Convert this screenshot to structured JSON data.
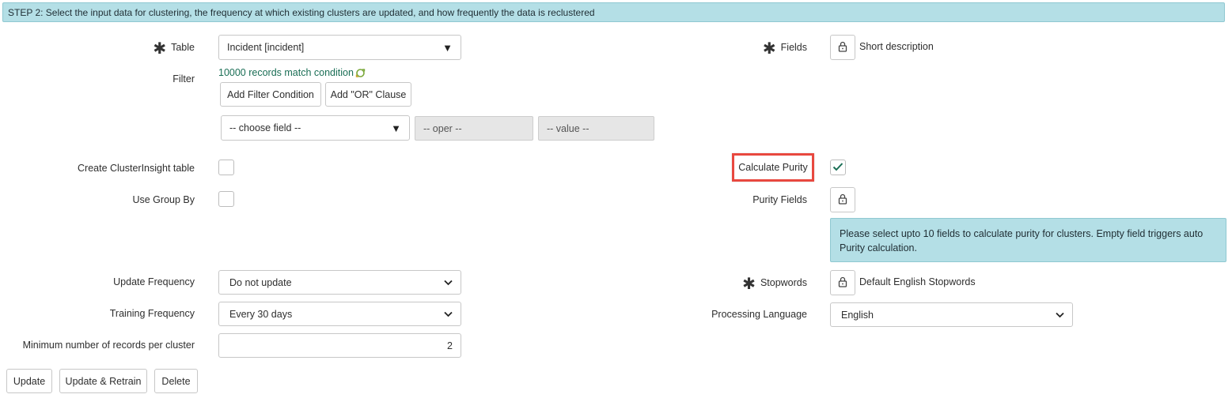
{
  "banner": "STEP 2: Select the input data for clustering, the frequency at which existing clusters are updated, and how frequently the data is reclustered",
  "required_marker": "✱",
  "table": {
    "label": "Table",
    "value": "Incident [incident]"
  },
  "filter": {
    "label": "Filter",
    "match_text": "10000 records match condition",
    "add_condition_label": "Add Filter Condition",
    "add_or_label": "Add \"OR\" Clause",
    "choose_field": "-- choose field --",
    "oper": "-- oper --",
    "value": "-- value --"
  },
  "fields": {
    "label": "Fields",
    "value": "Short description"
  },
  "create_clusterinsight": {
    "label": "Create ClusterInsight table",
    "checked": false
  },
  "use_group_by": {
    "label": "Use Group By",
    "checked": false
  },
  "calculate_purity": {
    "label": "Calculate Purity",
    "checked": true
  },
  "purity_fields": {
    "label": "Purity Fields",
    "info": "Please select upto 10 fields to calculate purity for clusters. Empty field triggers auto Purity calculation."
  },
  "update_frequency": {
    "label": "Update Frequency",
    "value": "Do not update"
  },
  "training_frequency": {
    "label": "Training Frequency",
    "value": "Every 30 days"
  },
  "min_records": {
    "label": "Minimum number of records per cluster",
    "value": "2"
  },
  "stopwords": {
    "label": "Stopwords",
    "value": "Default English Stopwords"
  },
  "processing_language": {
    "label": "Processing Language",
    "value": "English"
  },
  "buttons": {
    "update": "Update",
    "update_retrain": "Update & Retrain",
    "delete": "Delete"
  },
  "colors": {
    "accent_green": "#1a6e55",
    "info_bg": "#b4dfe6",
    "highlight_red": "#e8483f"
  },
  "icons": {
    "lock": "lock-icon",
    "check": "check-icon",
    "refresh": "refresh-icon",
    "caret": "caret-down-icon",
    "chevron": "chevron-down-icon"
  }
}
